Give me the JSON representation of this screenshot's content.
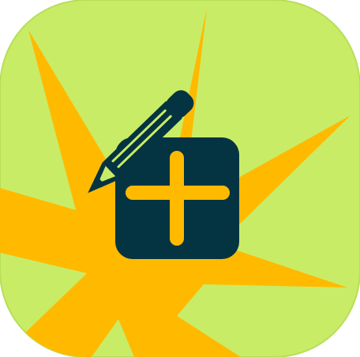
{
  "icon": {
    "name": "add-note-icon",
    "parts": [
      "rounded-square-tile",
      "starburst",
      "pencil-icon",
      "plus-square-icon"
    ],
    "colors": {
      "tile": "#C9EC67",
      "tile_edge": "#B8DE57",
      "starburst": "#FFBA00",
      "glyph": "#043441",
      "plus": "#FFBA00"
    }
  }
}
